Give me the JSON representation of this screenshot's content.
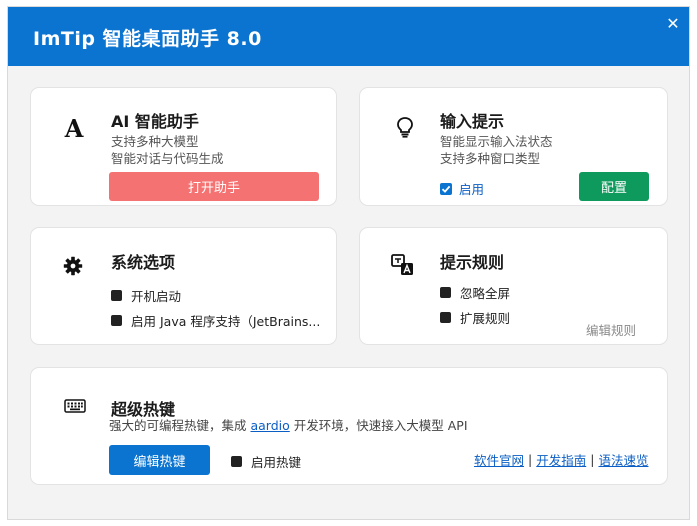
{
  "window": {
    "title": "ImTip 智能桌面助手 8.0",
    "close_glyph": "✕"
  },
  "ai_card": {
    "title": "AI 智能助手",
    "desc_line1": "支持多种大模型",
    "desc_line2": "智能对话与代码生成",
    "button": "打开助手"
  },
  "input_card": {
    "title": "输入提示",
    "desc_line1": "智能显示输入法状态",
    "desc_line2": "支持多种窗口类型",
    "enable_label": "启用",
    "enable_checked": true,
    "button": "配置"
  },
  "system_card": {
    "title": "系统选项",
    "option1": "开机启动",
    "option2": "启用 Java 程序支持（JetBrains..."
  },
  "rules_card": {
    "title": "提示规则",
    "option1": "忽略全屏",
    "option2": "扩展规则",
    "edit_link": "编辑规则"
  },
  "hotkey_card": {
    "title": "超级热键",
    "desc_prefix": "强大的可编程热键，集成 ",
    "desc_link": "aardio",
    "desc_suffix": " 开发环境，快速接入大模型 API",
    "button": "编辑热键",
    "enable_label": "启用热键",
    "links": [
      "软件官网",
      "开发指南",
      "语法速览"
    ],
    "separator": "|"
  },
  "colors": {
    "titlebar": "#0b74d0",
    "primary_button": "#0b74d0",
    "danger_button": "#f47272",
    "success_button": "#0e9a5c",
    "link": "#0b5ec4"
  }
}
